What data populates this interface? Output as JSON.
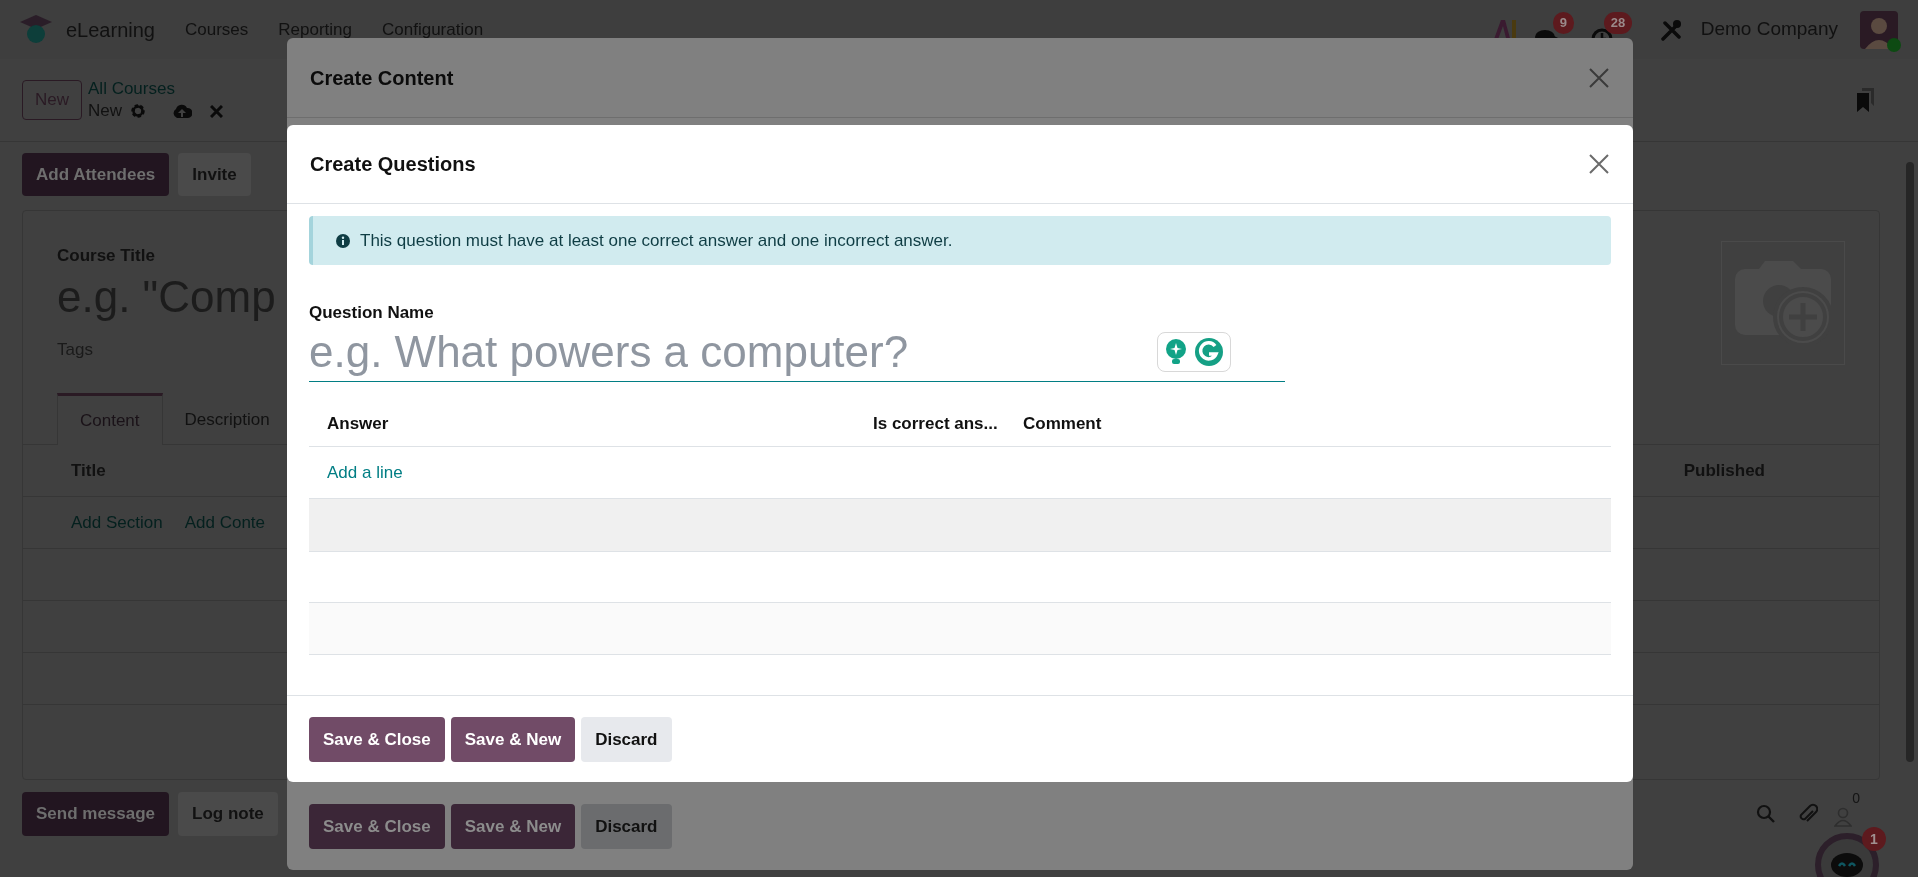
{
  "navbar": {
    "app_name": "eLearning",
    "menu": [
      "Courses",
      "Reporting",
      "Configuration"
    ],
    "messages_count": "9",
    "activities_count": "28",
    "company": "Demo Company"
  },
  "control_panel": {
    "new_button": "New",
    "breadcrumb": "All Courses",
    "record_name": "New"
  },
  "form": {
    "buttons": [
      {
        "label": "Add Attendees",
        "kind": "primary"
      },
      {
        "label": "Invite",
        "kind": "secondary"
      }
    ],
    "title_label": "Course Title",
    "title_placeholder": "e.g. \"Comp",
    "tags_placeholder": "Tags",
    "tabs": [
      {
        "label": "Content",
        "selected": true
      },
      {
        "label": "Description",
        "selected": false
      }
    ],
    "columns": [
      "Title",
      "Published"
    ],
    "actions": [
      "Add Section",
      "Add Conte"
    ]
  },
  "chatter": {
    "buttons": [
      {
        "label": "Send message",
        "kind": "primary"
      },
      {
        "label": "Log note",
        "kind": "secondary"
      }
    ],
    "followers_count": "0"
  },
  "assistant_badge": "1",
  "content_dialog": {
    "title": "Create Content",
    "buttons": [
      {
        "label": "Save & Close",
        "kind": "primary"
      },
      {
        "label": "Save & New",
        "kind": "primary"
      },
      {
        "label": "Discard",
        "kind": "secondary"
      }
    ]
  },
  "question_dialog": {
    "title": "Create Questions",
    "alert": "This question must have at least one correct answer and one incorrect answer.",
    "field_label": "Question Name",
    "placeholder": "e.g. What powers a computer?",
    "columns": [
      "Answer",
      "Is correct ans...",
      "Comment"
    ],
    "add_line": "Add a line",
    "buttons": [
      {
        "label": "Save & Close",
        "kind": "primary"
      },
      {
        "label": "Save & New",
        "kind": "primary"
      },
      {
        "label": "Discard",
        "kind": "secondary"
      }
    ]
  }
}
